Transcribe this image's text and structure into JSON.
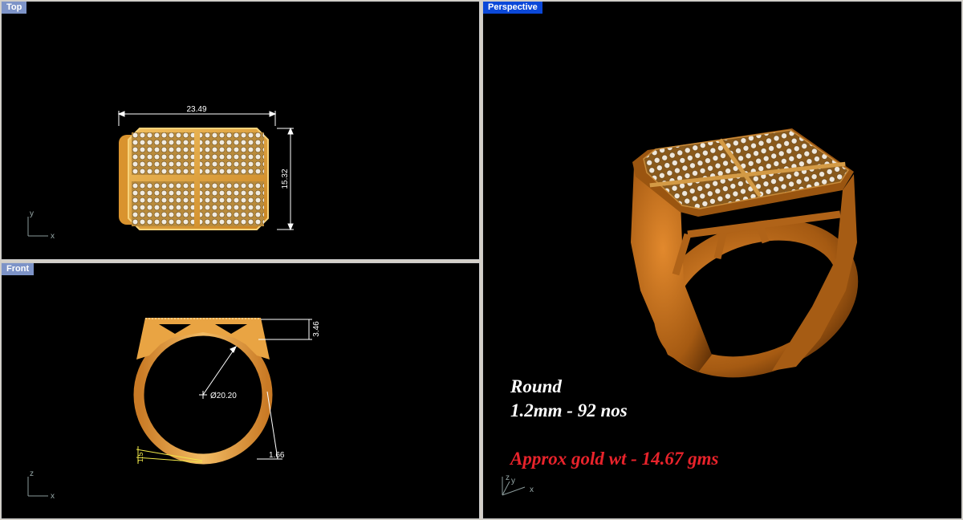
{
  "viewports": {
    "top": {
      "title": "Top",
      "axis_v": "y",
      "axis_h": "x"
    },
    "front": {
      "title": "Front",
      "axis_v": "z",
      "axis_h": "x"
    },
    "perspective": {
      "title": "Perspective",
      "axis_v": "z",
      "axis_y": "y",
      "axis_h": "x"
    }
  },
  "dimensions": {
    "width": "23.49",
    "length": "15.32",
    "height": "3.46",
    "diameter": "Ø20.20",
    "shank": "1.66",
    "base": "1.5"
  },
  "notes": {
    "stone_shape": "Round",
    "stone_spec": "1.2mm - 92 nos",
    "gold_weight": "Approx gold wt - 14.67 gms"
  },
  "colors": {
    "viewport_bg": "#000000",
    "active_title": "#0b48d8",
    "inactive_title": "#7d93c7",
    "gold": "#e8a33a",
    "warning_text": "#e8232b"
  }
}
